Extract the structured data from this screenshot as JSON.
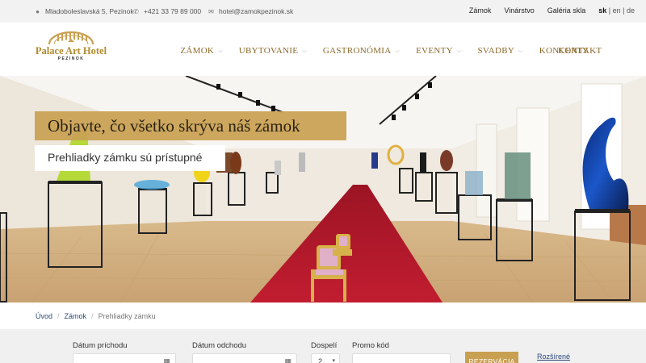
{
  "topbar": {
    "address": "Mladoboleslavská 5, Pezinok",
    "phone": "+421 33 79 89 000",
    "email": "hotel@zamokpezinok.sk",
    "links": [
      "Zámok",
      "Vinárstvo",
      "Galéria skla"
    ],
    "lang_active": "sk",
    "lang_rest": "| en | de",
    "icons": [
      "map-marker-icon",
      "phone-icon",
      "envelope-icon"
    ]
  },
  "logo": {
    "name": "Palace Art Hotel",
    "city": "PEZINOK"
  },
  "nav": {
    "items": [
      "ZÁMOK",
      "UBYTOVANIE",
      "GASTRONÓMIA",
      "EVENTY",
      "SVADBY",
      "KONCERTY"
    ],
    "contact": "KONTAKT"
  },
  "hero": {
    "title": "Objavte, čo všetko skrýva náš zámok",
    "subtitle": "Prehliadky zámku sú prístupné"
  },
  "breadcrumb": {
    "home": "Úvod",
    "section": "Zámok",
    "current": "Prehliadky zámku",
    "separator": "/"
  },
  "booking": {
    "arrival_label": "Dátum príchodu",
    "departure_label": "Dátum odchodu",
    "adults_label": "Dospelí",
    "adults_value": "2",
    "promo_label": "Promo kód",
    "reserve_button": "REZERVÁCIA",
    "advanced_link": "Rozšírené"
  },
  "colors": {
    "gold": "#c9a052",
    "nav_text": "#8a6a2a",
    "carpet": "#b5182b",
    "link": "#2c4a7a"
  }
}
